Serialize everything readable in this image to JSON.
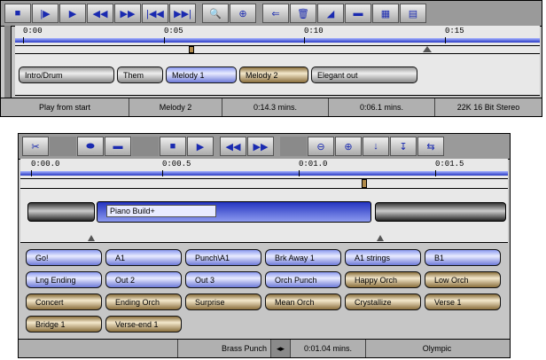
{
  "win1": {
    "toolbar_icons": [
      "stop-icon",
      "play-from-start-icon",
      "play-icon",
      "rewind-icon",
      "fast-forward-icon",
      "skip-back-icon",
      "skip-forward-icon",
      "magnify-icon",
      "zoom-icon",
      "insert-arrow-icon",
      "trash-icon",
      "cursor-icon",
      "blue-bar-icon",
      "grid-icon",
      "grid-alt-icon"
    ],
    "ruler_labels": [
      "0:00",
      "0:05",
      "0:10",
      "0:15"
    ],
    "segments": [
      {
        "label": "Intro/Drum",
        "style": "gray"
      },
      {
        "label": "Them",
        "style": "gray"
      },
      {
        "label": "Melody 1",
        "style": "blue"
      },
      {
        "label": "Melody 2",
        "style": "tan"
      },
      {
        "label": "Elegant out",
        "style": "gray"
      }
    ],
    "status": {
      "mode": "Play from start",
      "section": "Melody 2",
      "total": "0:14.3 mins.",
      "position": "0:06.1 mins.",
      "format": "22K 16 Bit Stereo"
    }
  },
  "win2": {
    "toolbar_icons": [
      "scissors-icon",
      "blank-icon",
      "blue-button-icon",
      "blue-bar-icon",
      "blank-icon",
      "stop-icon",
      "play-icon",
      "rewind-icon",
      "fast-forward-icon",
      "blank-icon",
      "zoom-out-icon",
      "zoom-in-icon",
      "marker-icon",
      "marker-alt-icon",
      "split-arrows-icon"
    ],
    "ruler_labels": [
      "0:00.0",
      "0:00.5",
      "0:01.0",
      "0:01.5"
    ],
    "track_label": "Piano Build+",
    "chips": [
      [
        {
          "label": "Go!",
          "style": "blue"
        },
        {
          "label": "A1",
          "style": "blue"
        },
        {
          "label": "Punch\\A1",
          "style": "blue"
        },
        {
          "label": "Brk Away 1",
          "style": "blue"
        },
        {
          "label": "A1 strings",
          "style": "blue"
        },
        {
          "label": "B1",
          "style": "blue"
        }
      ],
      [
        {
          "label": "Lng Ending",
          "style": "blue"
        },
        {
          "label": "Out 2",
          "style": "blue"
        },
        {
          "label": "Out 3",
          "style": "blue"
        },
        {
          "label": "Orch Punch",
          "style": "blue"
        },
        {
          "label": "Happy Orch",
          "style": "tan"
        },
        {
          "label": "Low Orch",
          "style": "tan"
        }
      ],
      [
        {
          "label": "Concert",
          "style": "tan"
        },
        {
          "label": "Ending Orch",
          "style": "tan"
        },
        {
          "label": "Surprise",
          "style": "tan"
        },
        {
          "label": "Mean Orch",
          "style": "tan"
        },
        {
          "label": "Crystallize",
          "style": "tan"
        },
        {
          "label": "Verse 1",
          "style": "tan"
        }
      ],
      [
        {
          "label": "Bridge 1",
          "style": "tan"
        },
        {
          "label": "Verse-end 1",
          "style": "tan"
        }
      ]
    ],
    "status": {
      "sound": "Brass Punch",
      "length": "0:01.04 mins.",
      "bank": "Olympic"
    }
  }
}
